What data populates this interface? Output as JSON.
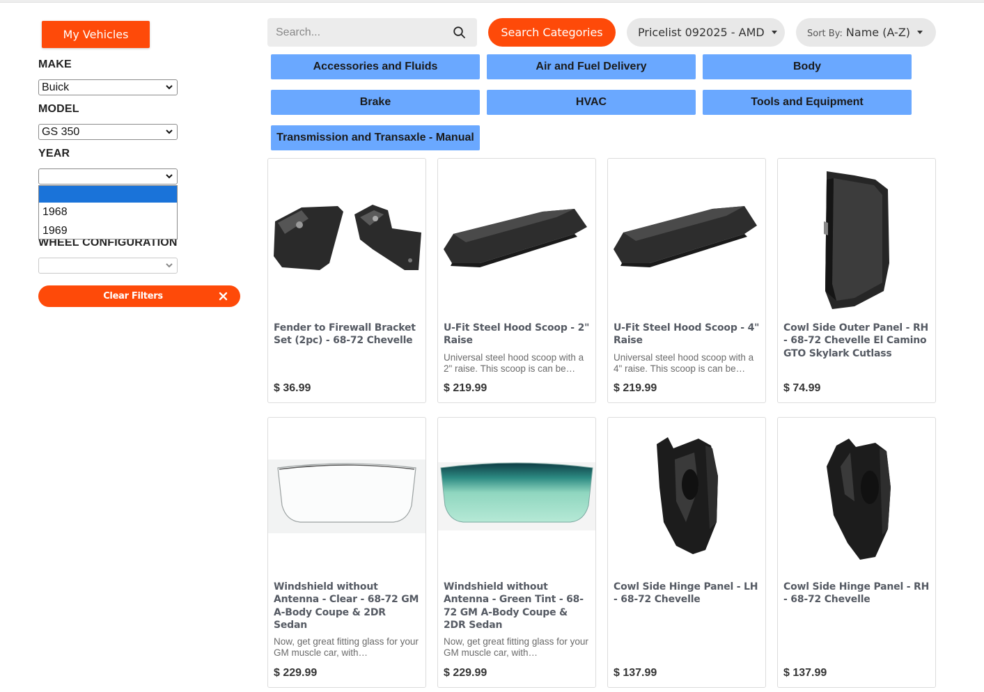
{
  "sidebar": {
    "my_vehicles_label": "My Vehicles",
    "make": {
      "label": "MAKE",
      "value": "Buick"
    },
    "model": {
      "label": "MODEL",
      "value": "GS 350"
    },
    "year": {
      "label": "YEAR",
      "value": "",
      "options": [
        "",
        "1968",
        "1969"
      ]
    },
    "wheel_config": {
      "label": "WHEEL CONFIGURATION",
      "value": ""
    },
    "clear_filters_label": "Clear Filters"
  },
  "toolbar": {
    "search_placeholder": "Search...",
    "search_categories_label": "Search Categories",
    "pricelist_value": "Pricelist 092025 - AMD",
    "sort_prefix": "Sort By:",
    "sort_value": "Name (A-Z)"
  },
  "categories": [
    "Accessories and Fluids",
    "Air and Fuel Delivery",
    "Body",
    "Brake",
    "HVAC",
    "Tools and Equipment",
    "Transmission and Transaxle - Manual"
  ],
  "products": [
    {
      "title": "Fender to Firewall Bracket Set (2pc) - 68-72 Chevelle",
      "desc": "",
      "price": "$ 36.99",
      "image": "bracket-set"
    },
    {
      "title": "U-Fit Steel Hood Scoop - 2\" Raise",
      "desc": "Universal steel hood scoop with a 2\" raise. This scoop is can be…",
      "price": "$ 219.99",
      "image": "hood-scoop"
    },
    {
      "title": "U-Fit Steel Hood Scoop - 4\" Raise",
      "desc": "Universal steel hood scoop with a 4\" raise. This scoop is can be…",
      "price": "$ 219.99",
      "image": "hood-scoop"
    },
    {
      "title": "Cowl Side Outer Panel - RH - 68-72 Chevelle El Camino GTO Skylark Cutlass",
      "desc": "",
      "price": "$ 74.99",
      "image": "cowl-outer-panel"
    },
    {
      "title": "Windshield without Antenna - Clear - 68-72 GM A-Body Coupe & 2DR Sedan",
      "desc": "Now, get great fitting glass for your GM muscle car, with…",
      "price": "$ 229.99",
      "image": "windshield-clear"
    },
    {
      "title": "Windshield without Antenna - Green Tint - 68-72 GM A-Body Coupe & 2DR Sedan",
      "desc": "Now, get great fitting glass for your GM muscle car, with…",
      "price": "$ 229.99",
      "image": "windshield-green"
    },
    {
      "title": "Cowl Side Hinge Panel - LH - 68-72 Chevelle",
      "desc": "",
      "price": "$ 137.99",
      "image": "hinge-panel-lh"
    },
    {
      "title": "Cowl Side Hinge Panel - RH - 68-72 Chevelle",
      "desc": "",
      "price": "$ 137.99",
      "image": "hinge-panel-rh"
    }
  ],
  "colors": {
    "accent": "#fe4a09",
    "chip": "#6aa8ff",
    "selected_option": "#1a73d9"
  }
}
